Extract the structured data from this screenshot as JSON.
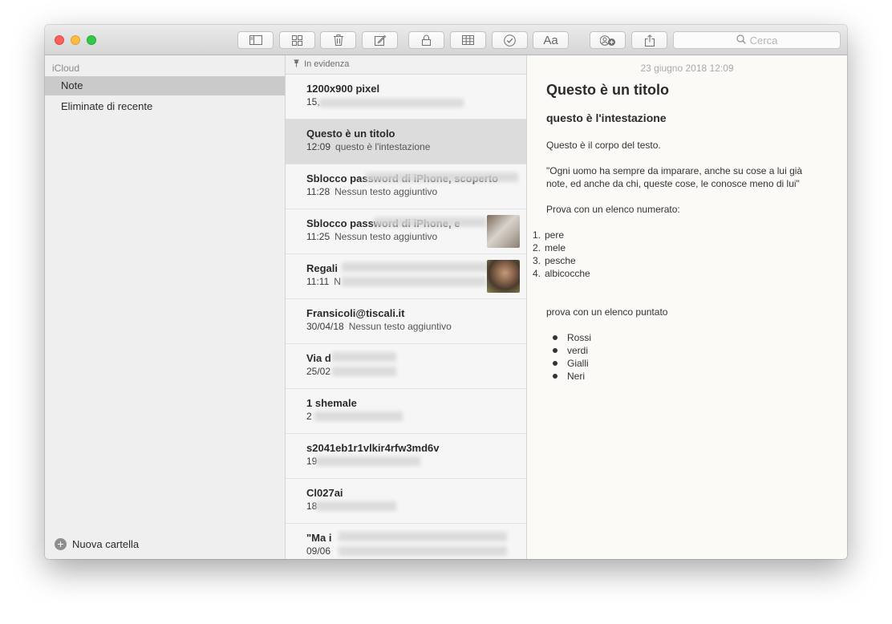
{
  "window": {
    "title": "Note"
  },
  "toolbar": {
    "buttons": [
      {
        "name": "sidebar-toggle",
        "icon": "sidebar-icon"
      },
      {
        "name": "gallery-view",
        "icon": "grid-icon"
      },
      {
        "name": "delete",
        "icon": "trash-icon"
      },
      {
        "name": "new-note",
        "icon": "compose-icon"
      },
      {
        "name": "lock",
        "icon": "lock-icon"
      },
      {
        "name": "table",
        "icon": "table-icon"
      },
      {
        "name": "checklist",
        "icon": "checkmark-circle-icon"
      },
      {
        "name": "format",
        "icon": "text-format-icon",
        "label": "Aa"
      },
      {
        "name": "add-people",
        "icon": "add-people-icon"
      },
      {
        "name": "share",
        "icon": "share-icon"
      }
    ],
    "search_placeholder": "Cerca"
  },
  "sidebar": {
    "account": "iCloud",
    "items": [
      {
        "label": "Note",
        "selected": true
      },
      {
        "label": "Eliminate di recente",
        "selected": false
      }
    ],
    "new_folder_label": "Nuova cartella"
  },
  "note_list": {
    "pinned_header": "In evidenza",
    "notes": [
      {
        "title": "1200x900 pixel",
        "time": "15,",
        "preview": ""
      },
      {
        "title": "Questo è un titolo",
        "time": "12:09",
        "preview": "questo è l'intestazione"
      },
      {
        "title": "Sblocco password di iPhone, scoperto",
        "time": "11:28",
        "preview": "Nessun testo aggiuntivo"
      },
      {
        "title": "Sblocco password di iPhone, e",
        "time": "11:25",
        "preview": "Nessun testo aggiuntivo"
      },
      {
        "title": "Regali",
        "time": "11:11",
        "preview": "N"
      },
      {
        "title": "Fransicoli@tiscali.it",
        "time": "30/04/18",
        "preview": "Nessun testo aggiuntivo"
      },
      {
        "title": "Via d",
        "time": "25/02",
        "preview": ""
      },
      {
        "title": "1 shemale",
        "time": "2",
        "preview": ""
      },
      {
        "title": "s2041eb1r1vlkir4rfw3md6v",
        "time": "19",
        "preview": ""
      },
      {
        "title": "Cl027ai",
        "time": "18",
        "preview": ""
      },
      {
        "title": "\"Ma i",
        "time": "09/06",
        "preview": ""
      }
    ]
  },
  "editor": {
    "date": "23 giugno 2018 12:09",
    "title": "Questo è un titolo",
    "heading": "questo è l'intestazione",
    "body": "Questo è il corpo del testo.",
    "quote_line1": "\"Ogni uomo ha sempre da imparare, anche su cose a lui già",
    "quote_line2": "note, ed anche da chi, queste cose, le conosce meno di lui\"",
    "numbered_intro": "Prova con un elenco numerato:",
    "numbered": [
      "pere",
      "mele",
      "pesche",
      "albicocche"
    ],
    "bulleted_intro": "prova con un elenco puntato",
    "bulleted": [
      "Rossi",
      "verdi",
      "Gialli",
      "Neri"
    ]
  }
}
